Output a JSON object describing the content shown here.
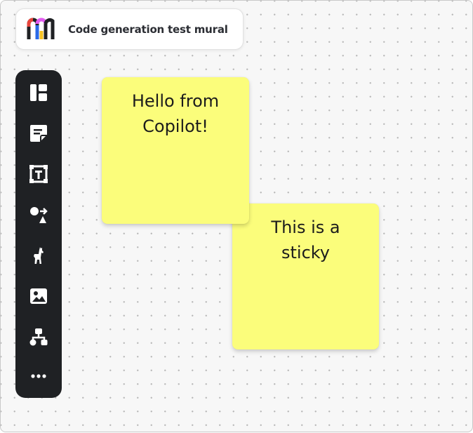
{
  "mural": {
    "title": "Code generation test mural",
    "logo_icon": "mural-logo-icon",
    "logo_colors": [
      "#e8453c",
      "#2b6be8",
      "#f7c325",
      "#e25cf0",
      "#1f2124"
    ]
  },
  "toolbar": {
    "items": [
      {
        "name": "templates",
        "icon": "layout-panels-icon"
      },
      {
        "name": "sticky-note",
        "icon": "sticky-note-icon"
      },
      {
        "name": "text",
        "icon": "text-box-icon"
      },
      {
        "name": "shapes",
        "icon": "shapes-connector-icon"
      },
      {
        "name": "icons",
        "icon": "llama-icon"
      },
      {
        "name": "image",
        "icon": "image-icon"
      },
      {
        "name": "diagram",
        "icon": "diagram-icon"
      },
      {
        "name": "more",
        "icon": "more-dots-icon"
      }
    ]
  },
  "stickies": [
    {
      "lines": [
        "Hello from",
        "Copilot!"
      ],
      "color": "#fbfd7b"
    },
    {
      "lines": [
        "This is a",
        "sticky"
      ],
      "color": "#fbfd7b"
    }
  ],
  "colors": {
    "canvas": "#f7f7f7",
    "grid_dot": "#b9b9b9",
    "toolbar": "#1f2124",
    "sticky": "#fbfd7b"
  }
}
